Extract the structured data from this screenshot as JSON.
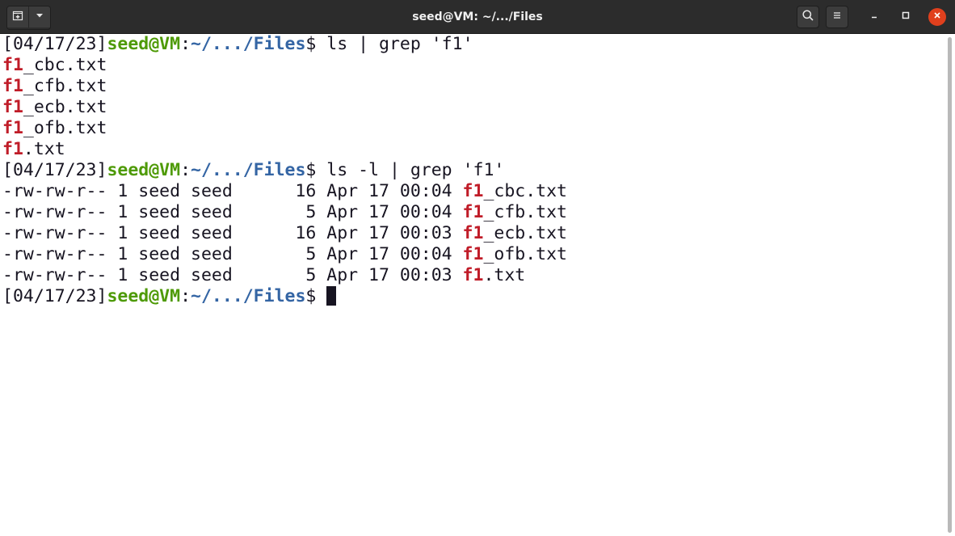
{
  "window": {
    "title": "seed@VM: ~/.../Files",
    "header_left": {
      "new_tab_icon": "new-tab-icon",
      "menu_icon": "chevron-down-icon"
    },
    "header_right": {
      "search_icon": "search-icon",
      "menu_icon": "hamburger-menu-icon"
    },
    "controls": {
      "minimize_icon": "minimize-icon",
      "maximize_icon": "maximize-icon",
      "close_icon": "close-icon"
    }
  },
  "colors": {
    "titlebar": "#2c2c2c",
    "prompt_user": "#4e9a06",
    "prompt_path": "#3465a4",
    "grep_match": "#c01c28",
    "close_button": "#e0401d"
  },
  "terminal": {
    "prompt": {
      "date": "[04/17/23]",
      "user": "seed@VM",
      "colon": ":",
      "path": "~/.../Files",
      "symbol": "$ "
    },
    "commands": [
      "ls | grep 'f1'",
      "ls -l | grep 'f1'"
    ],
    "ls_output": [
      {
        "match": "f1",
        "rest": "_cbc.txt"
      },
      {
        "match": "f1",
        "rest": "_cfb.txt"
      },
      {
        "match": "f1",
        "rest": "_ecb.txt"
      },
      {
        "match": "f1",
        "rest": "_ofb.txt"
      },
      {
        "match": "f1",
        "rest": ".txt"
      }
    ],
    "ls_l_output": [
      {
        "meta": "-rw-rw-r-- 1 seed seed      16 Apr 17 00:04 ",
        "match": "f1",
        "rest": "_cbc.txt"
      },
      {
        "meta": "-rw-rw-r-- 1 seed seed       5 Apr 17 00:04 ",
        "match": "f1",
        "rest": "_cfb.txt"
      },
      {
        "meta": "-rw-rw-r-- 1 seed seed      16 Apr 17 00:03 ",
        "match": "f1",
        "rest": "_ecb.txt"
      },
      {
        "meta": "-rw-rw-r-- 1 seed seed       5 Apr 17 00:04 ",
        "match": "f1",
        "rest": "_ofb.txt"
      },
      {
        "meta": "-rw-rw-r-- 1 seed seed       5 Apr 17 00:03 ",
        "match": "f1",
        "rest": ".txt"
      }
    ]
  }
}
